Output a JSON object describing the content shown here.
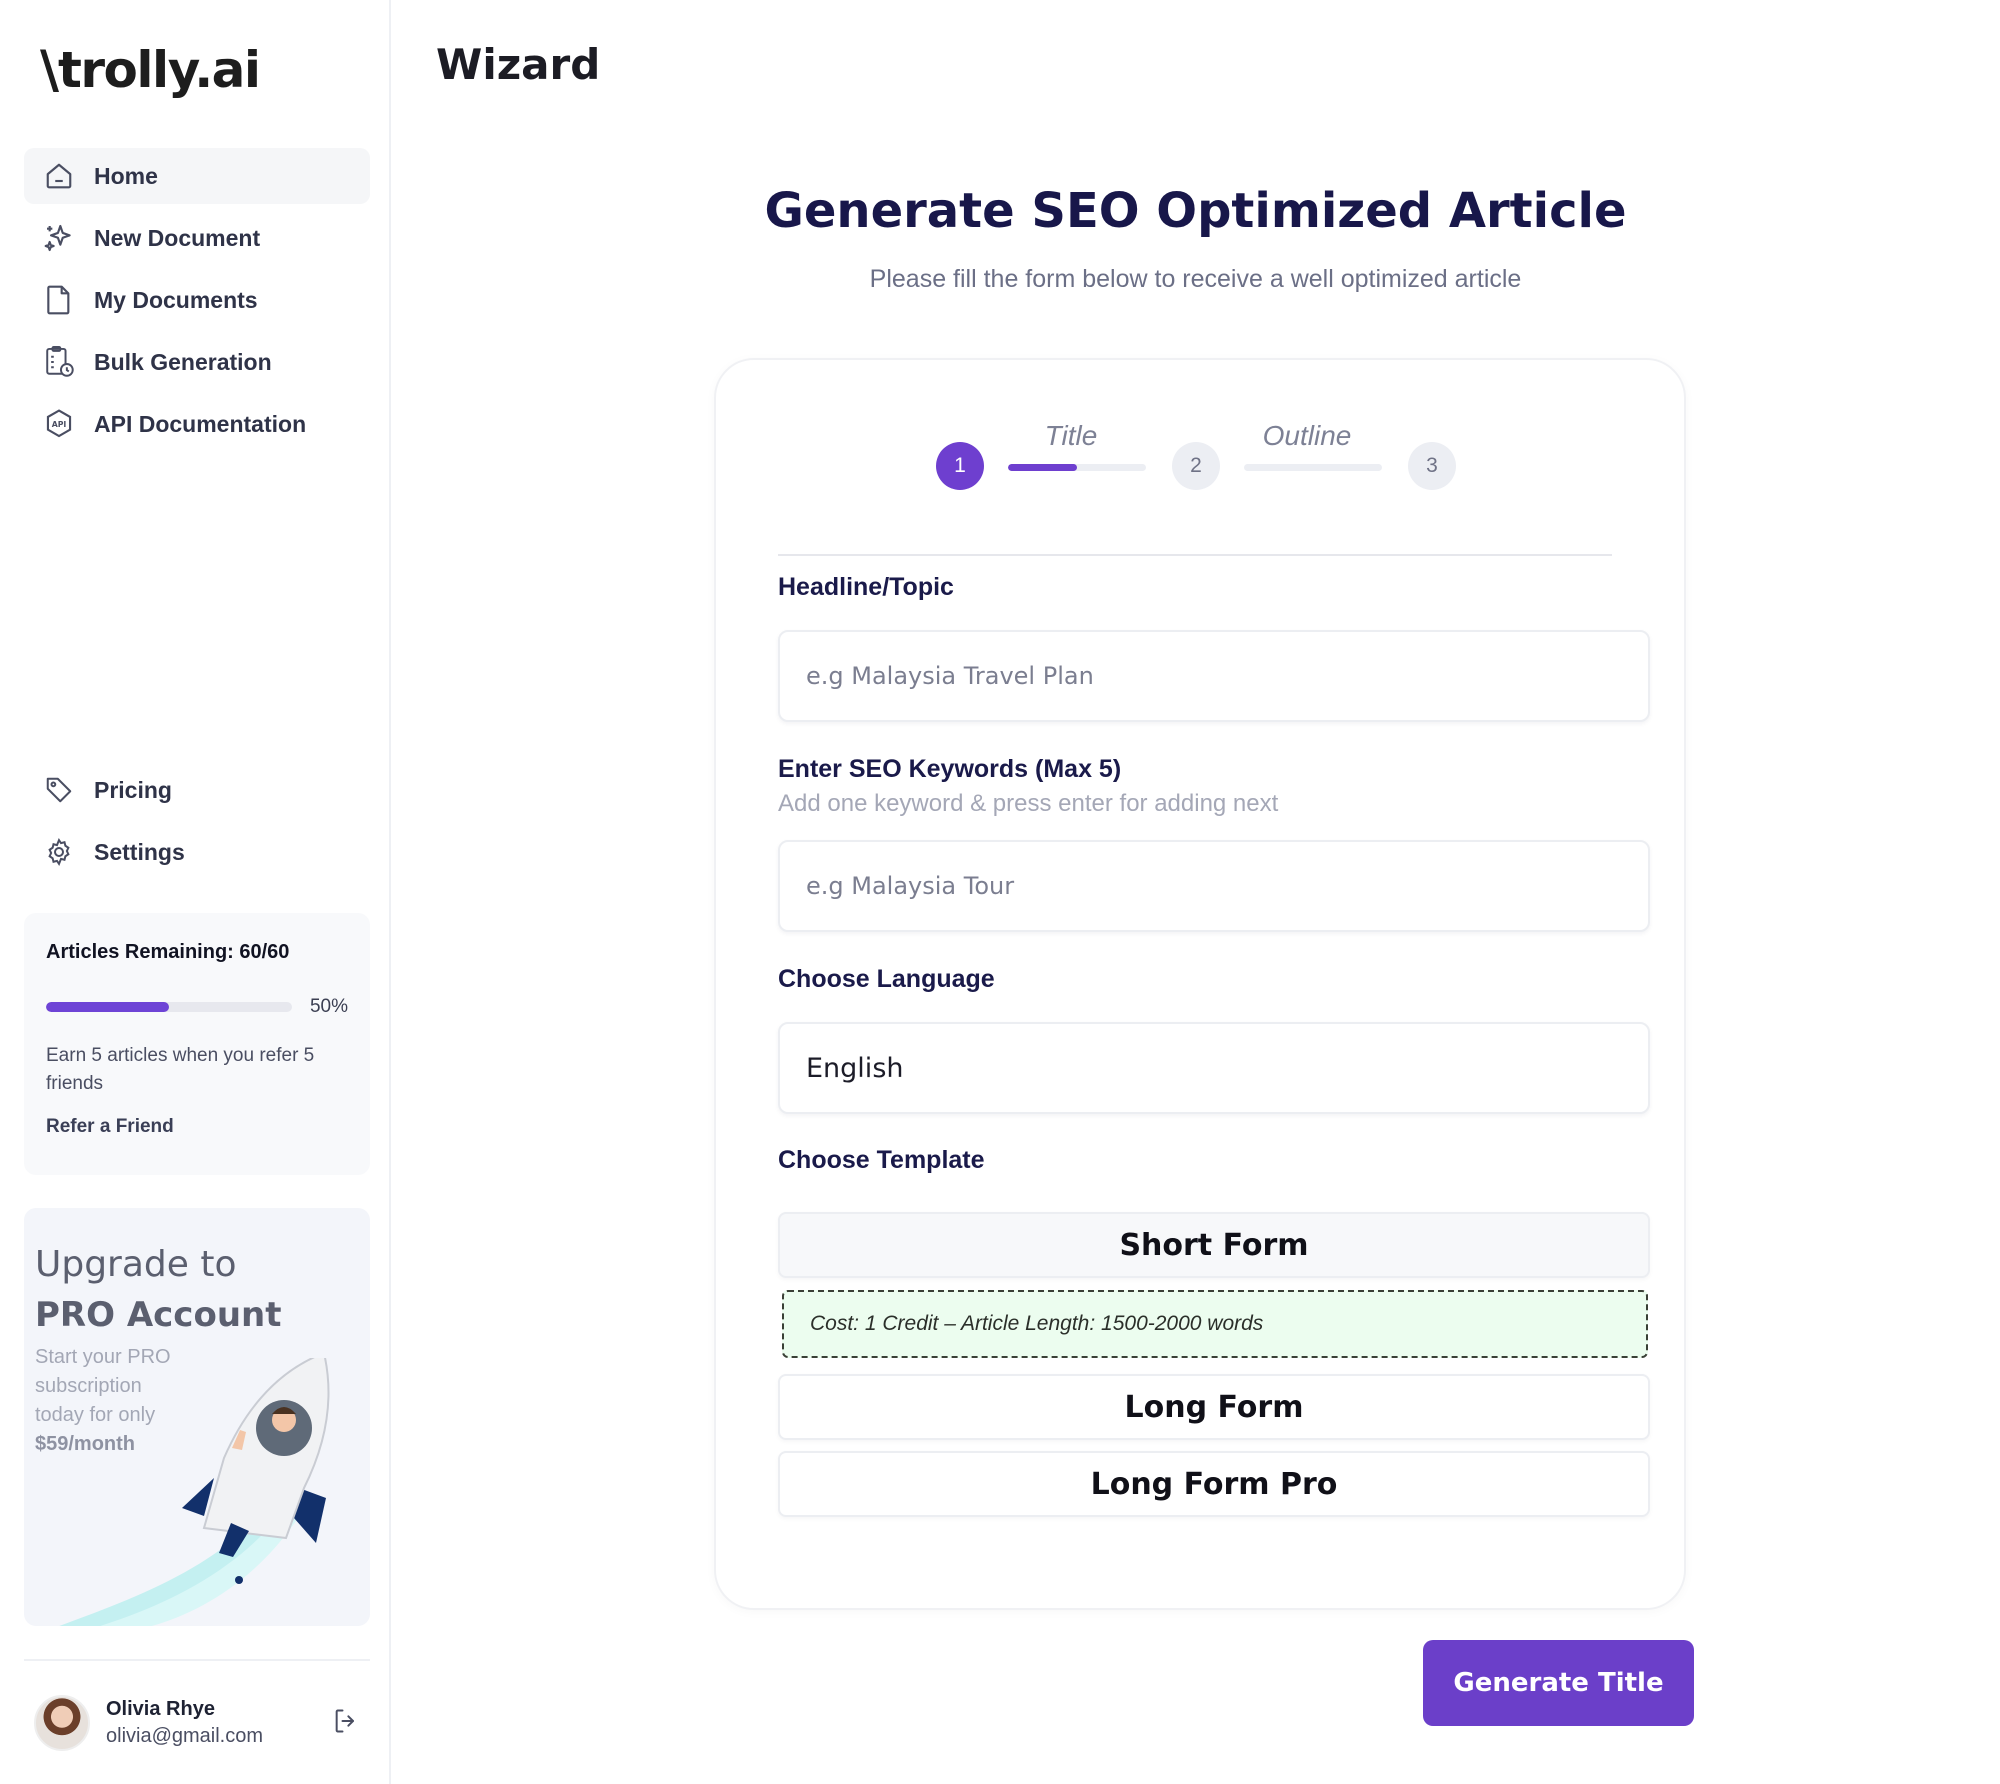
{
  "brand": {
    "mark": "\\",
    "name": "trolly.ai"
  },
  "sidebar": {
    "items": [
      {
        "label": "Home",
        "icon": "home-icon",
        "active": true
      },
      {
        "label": "New Document",
        "icon": "sparkles-icon"
      },
      {
        "label": "My Documents",
        "icon": "document-icon"
      },
      {
        "label": "Bulk Generation",
        "icon": "clipboard-clock-icon"
      },
      {
        "label": "API Documentation",
        "icon": "api-badge-icon"
      }
    ],
    "bottom_items": [
      {
        "label": "Pricing",
        "icon": "tag-icon"
      },
      {
        "label": "Settings",
        "icon": "gear-icon"
      }
    ]
  },
  "credits": {
    "title": "Articles Remaining: 60/60",
    "progress_fraction": 0.5,
    "progress_label": "50%",
    "note": "Earn 5 articles when you refer 5 friends",
    "refer_label": "Refer a Friend"
  },
  "upgrade": {
    "line1": "Upgrade to",
    "line2": "PRO Account",
    "desc": "Start your PRO subscription today for only",
    "price": "$59/month"
  },
  "user": {
    "name": "Olivia Rhye",
    "email": "olivia@gmail.com"
  },
  "page": {
    "title": "Wizard"
  },
  "hero": {
    "title": "Generate SEO Optimized Article",
    "subtitle": "Please fill the form below to receive a well optimized article"
  },
  "stepper": {
    "steps": [
      {
        "number": "1",
        "state": "active"
      },
      {
        "number": "2",
        "state": "inactive"
      },
      {
        "number": "3",
        "state": "inactive"
      }
    ],
    "labels": [
      "Title",
      "Outline"
    ],
    "progress": [
      0.5,
      0
    ]
  },
  "form": {
    "headline": {
      "label": "Headline/Topic",
      "placeholder": "e.g Malaysia Travel Plan",
      "value": ""
    },
    "keywords": {
      "label": "Enter SEO Keywords (Max 5)",
      "hint": "Add one keyword & press enter for adding next",
      "placeholder": "e.g Malaysia Tour",
      "value": ""
    },
    "language": {
      "label": "Choose Language",
      "value": "English"
    },
    "template": {
      "label": "Choose Template",
      "options": [
        "Short Form",
        "Long Form",
        "Long Form Pro"
      ],
      "selected": "Short Form",
      "info": "Cost: 1 Credit  –  Article Length: 1500-2000 words"
    }
  },
  "actions": {
    "generate_label": "Generate Title"
  },
  "colors": {
    "accent": "#6e3fcf",
    "info_bg": "#ecfdef",
    "heading": "#18174a"
  }
}
